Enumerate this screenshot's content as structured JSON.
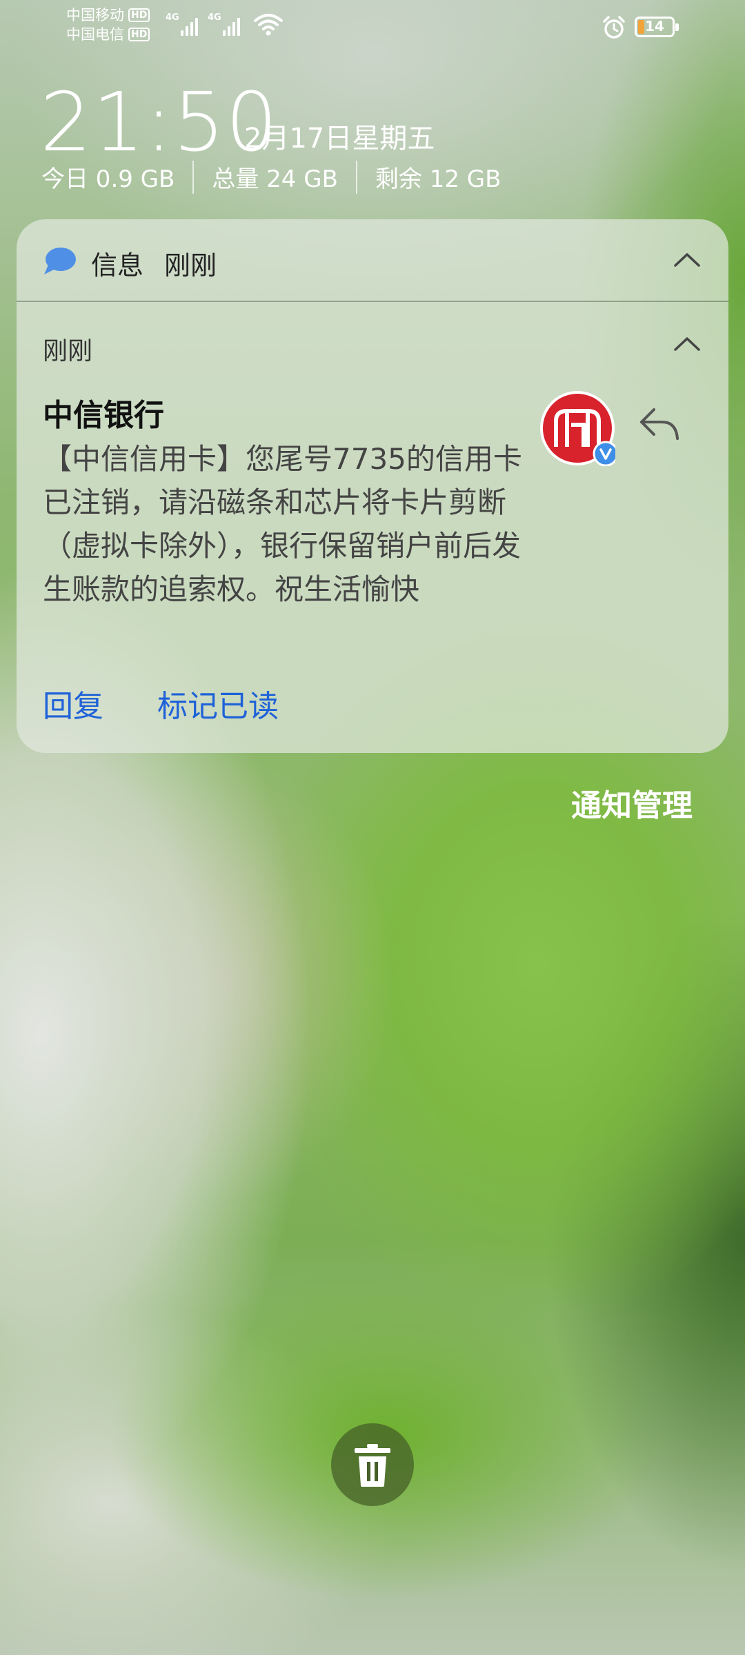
{
  "status_bar": {
    "carrier1": "中国移动",
    "carrier2": "中国电信",
    "hd_badge": "HD",
    "network1": "4G",
    "network2": "4G",
    "battery_level": "14",
    "battery_color": "#f2a43a"
  },
  "lockscreen": {
    "time": "21:50",
    "date": "2月17日星期五",
    "storage_today": "今日 0.9 GB",
    "storage_total": "总量 24 GB",
    "storage_remaining": "剩余 12 GB"
  },
  "notification": {
    "app_name": "信息",
    "app_time": "刚刚",
    "group_time": "刚刚",
    "sender": "中信银行",
    "body": "【中信信用卡】您尾号7735的信用卡已注销，请沿磁条和芯片将卡片剪断（虚拟卡除外），银行保留销户前后发生账款的追索权。祝生活愉快",
    "actions": {
      "reply": "回复",
      "mark_read": "标记已读"
    },
    "accent_color": "#1f62d8",
    "avatar_color": "#d8222c"
  },
  "footer": {
    "notification_manage": "通知管理"
  }
}
